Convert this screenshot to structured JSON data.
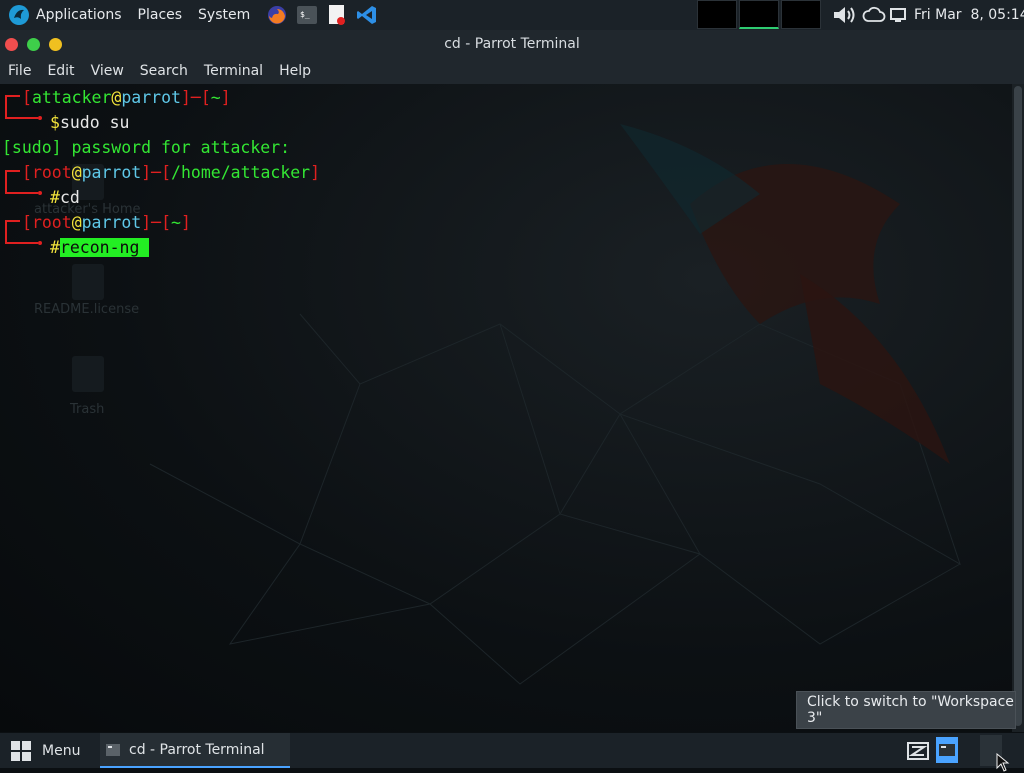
{
  "top_panel": {
    "applications_label": "Applications",
    "places_label": "Places",
    "system_label": "System",
    "launchers": [
      "firefox-icon",
      "terminal-icon",
      "text-editor-icon",
      "vscode-icon"
    ],
    "datetime": "Fri Mar  8, 05:14"
  },
  "window": {
    "title": "cd - Parrot Terminal",
    "menu": [
      "File",
      "Edit",
      "View",
      "Search",
      "Terminal",
      "Help"
    ]
  },
  "terminal": {
    "lines": [
      {
        "user": "attacker",
        "host": "parrot",
        "path": "~"
      },
      {
        "prompt": "$",
        "cmd": "sudo su"
      },
      {
        "text": "[sudo] password for attacker:"
      },
      {
        "user": "root",
        "host": "parrot",
        "path": "/home/attacker"
      },
      {
        "prompt": "#",
        "cmd": "cd"
      },
      {
        "user": "root",
        "host": "parrot",
        "path": "~"
      },
      {
        "prompt": "#",
        "cmd": "recon-ng"
      }
    ]
  },
  "desktop": {
    "icons": [
      "attacker's Home",
      "README.license",
      "Trash"
    ]
  },
  "tooltip": "Click to switch to \"Workspace 3\"",
  "bottom_panel": {
    "menu_label": "Menu",
    "task_label": "cd - Parrot Terminal"
  },
  "colors": {
    "prompt_bracket": "#e02020",
    "user": "#33e633",
    "host": "#5fc8e8",
    "highlight": "#23ee23"
  }
}
